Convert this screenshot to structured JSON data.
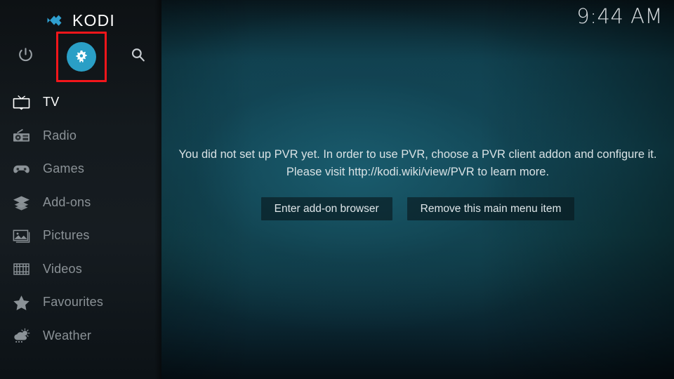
{
  "app": {
    "name": "KODI",
    "logo_icon": "kodi-logo-icon",
    "accent_color": "#2a9fc6",
    "highlight_color": "#f3161b"
  },
  "header": {
    "clock": "9:44 AM",
    "buttons": [
      {
        "name": "power",
        "label": "Power",
        "icon": "power-icon"
      },
      {
        "name": "settings",
        "label": "Settings",
        "icon": "gear-icon",
        "selected": true
      },
      {
        "name": "search",
        "label": "Search",
        "icon": "search-icon"
      }
    ]
  },
  "sidebar": {
    "items": [
      {
        "label": "TV",
        "icon": "tv-icon",
        "active": true
      },
      {
        "label": "Radio",
        "icon": "radio-icon",
        "active": false
      },
      {
        "label": "Games",
        "icon": "gamepad-icon",
        "active": false
      },
      {
        "label": "Add-ons",
        "icon": "addons-box-icon",
        "active": false
      },
      {
        "label": "Pictures",
        "icon": "picture-icon",
        "active": false
      },
      {
        "label": "Videos",
        "icon": "filmstrip-icon",
        "active": false
      },
      {
        "label": "Favourites",
        "icon": "star-icon",
        "active": false
      },
      {
        "label": "Weather",
        "icon": "weather-icon",
        "active": false
      }
    ]
  },
  "main": {
    "message_line1": "You did not set up PVR yet. In order to use PVR, choose a PVR client addon and configure it.",
    "message_line2": "Please visit http://kodi.wiki/view/PVR to learn more.",
    "buttons": [
      {
        "label": "Enter add-on browser"
      },
      {
        "label": "Remove this main menu item"
      }
    ]
  }
}
